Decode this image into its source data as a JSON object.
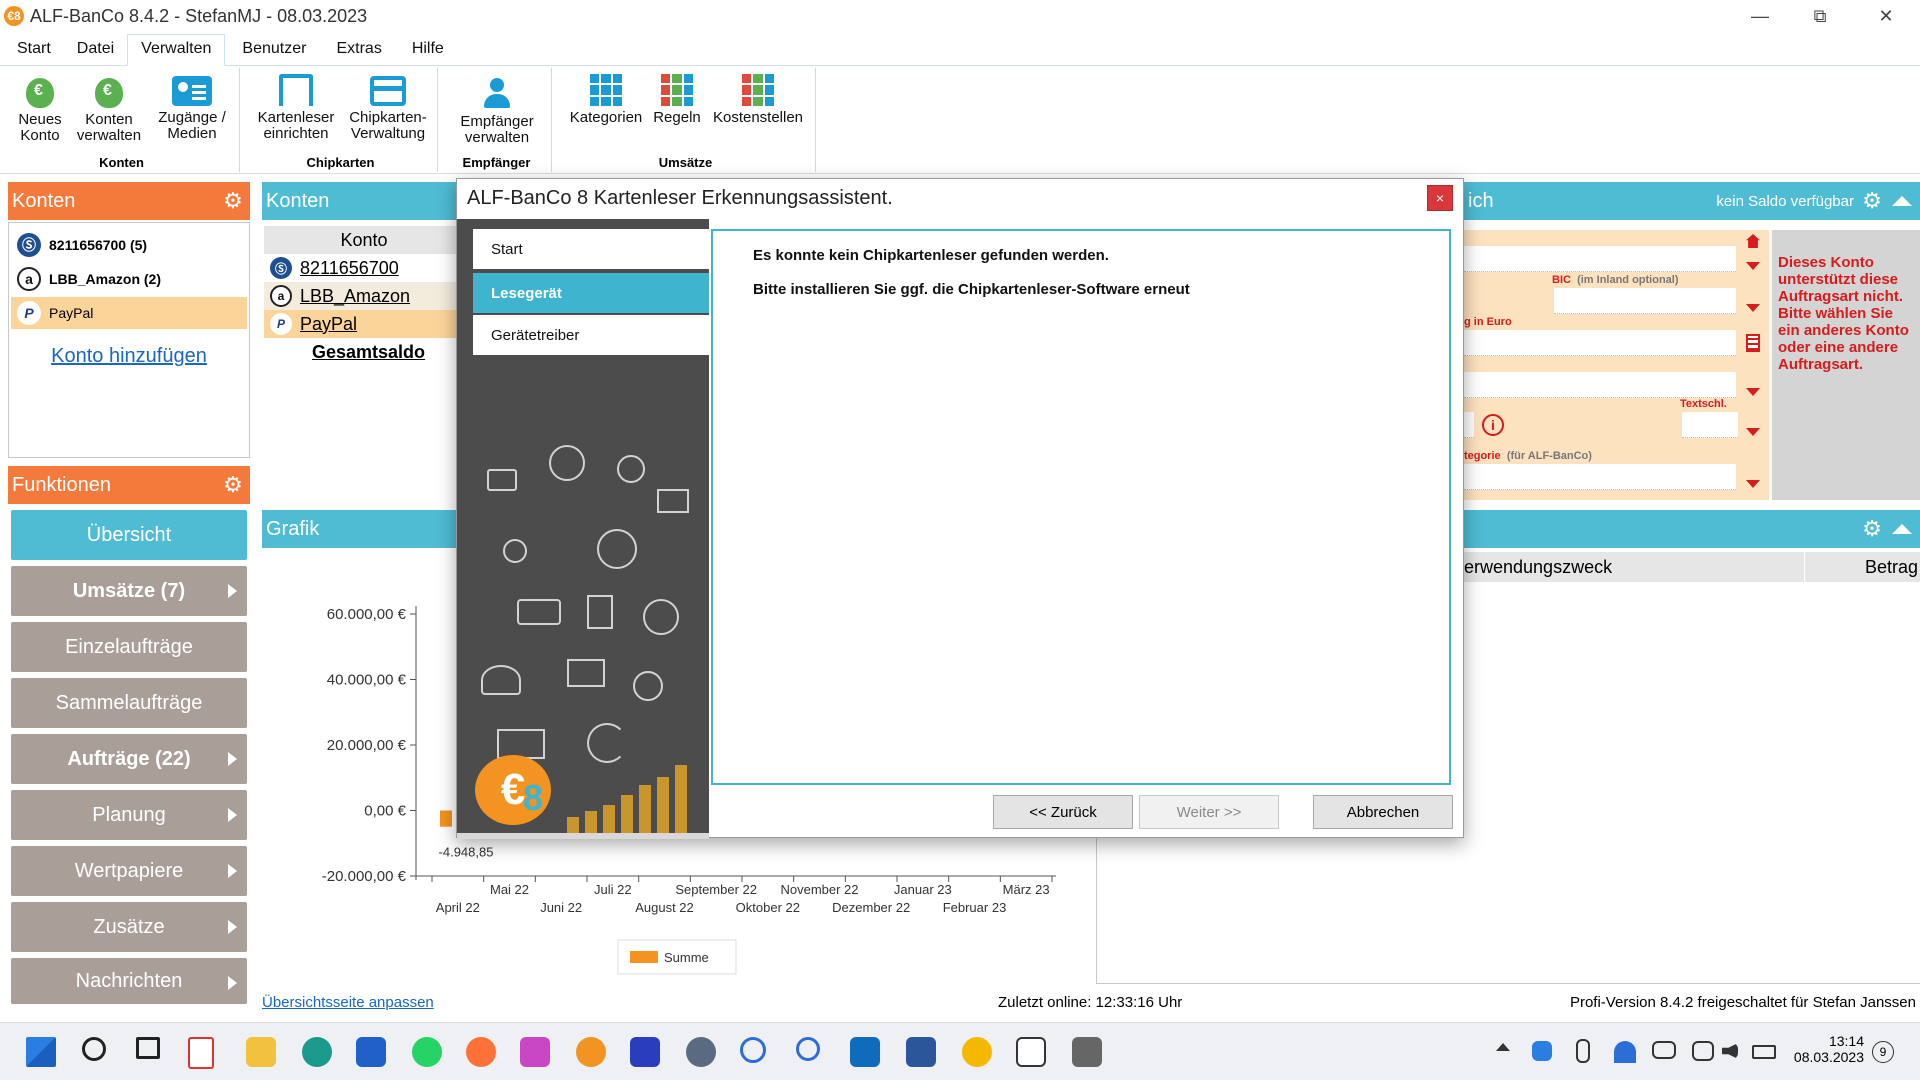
{
  "window": {
    "title": "ALF-BanCo 8.4.2 - StefanMJ   - 08.03.2023",
    "app_icon_glyph": "€8"
  },
  "menu": {
    "tabs": [
      "Start",
      "Datei",
      "Verwalten",
      "Benutzer",
      "Extras",
      "Hilfe"
    ],
    "active_tab": "Verwalten"
  },
  "ribbon": {
    "groups": {
      "konten": "Konten",
      "chipkarten": "Chipkarten",
      "empfaenger": "Empfänger",
      "umsaetze": "Umsätze"
    },
    "buttons": {
      "neues_konto_1": "Neues",
      "neues_konto_2": "Konto",
      "konten_verwalten_1": "Konten",
      "konten_verwalten_2": "verwalten",
      "zugaenge_1": "Zugänge /",
      "zugaenge_2": "Medien",
      "kartenleser_1": "Kartenleser",
      "kartenleser_2": "einrichten",
      "chipkarten_1": "Chipkarten-",
      "chipkarten_2": "Verwaltung",
      "empfaenger_1": "Empfänger",
      "empfaenger_2": "verwalten",
      "kategorien": "Kategorien",
      "regeln": "Regeln",
      "kostenstellen": "Kostenstellen"
    }
  },
  "left": {
    "konten_title": "Konten",
    "accounts": [
      {
        "name": "8211656700 (5)",
        "icon": "sparkasse-icon",
        "glyph": "Ⓢ"
      },
      {
        "name": "LBB_Amazon (2)",
        "icon": "amazon-icon",
        "glyph": "a"
      },
      {
        "name": "PayPal",
        "icon": "paypal-icon",
        "glyph": "P"
      }
    ],
    "add_account": "Konto hinzufügen",
    "funktionen_title": "Funktionen",
    "functions": [
      {
        "label": "Übersicht",
        "arrow": false,
        "bold": false
      },
      {
        "label": "Umsätze (7)",
        "arrow": true,
        "bold": true
      },
      {
        "label": "Einzelaufträge",
        "arrow": false,
        "bold": false
      },
      {
        "label": "Sammelaufträge",
        "arrow": false,
        "bold": false
      },
      {
        "label": "Aufträge (22)",
        "arrow": true,
        "bold": true
      },
      {
        "label": "Planung",
        "arrow": true,
        "bold": false
      },
      {
        "label": "Wertpapiere",
        "arrow": true,
        "bold": false
      },
      {
        "label": "Zusätze",
        "arrow": true,
        "bold": false
      },
      {
        "label": "Nachrichten",
        "arrow": true,
        "bold": false
      }
    ]
  },
  "middle": {
    "konten_title": "Konten",
    "table_header": "Konto",
    "rows": [
      "8211656700",
      "LBB_Amazon",
      "PayPal"
    ],
    "total": "Gesamtsaldo",
    "grafik_title": "Grafik"
  },
  "chart_data": {
    "type": "bar",
    "y_ticks": [
      "60.000,00 €",
      "40.000,00 €",
      "20.000,00 €",
      "0,00 €",
      "-20.000,00 €"
    ],
    "ylim": [
      -20000,
      60000
    ],
    "x_labels_upper": [
      "Mai 22",
      "Juli 22",
      "September 22",
      "November 22",
      "Januar 23",
      "März 23"
    ],
    "x_labels_lower": [
      "April 22",
      "Juni 22",
      "August 22",
      "Oktober 22",
      "Dezember 22",
      "Februar 23"
    ],
    "series": [
      {
        "name": "Summe",
        "values": [
          -4948.85
        ]
      }
    ],
    "data_label": "-4.948,85",
    "color": "#f39321"
  },
  "right": {
    "header_title_fragment": "ich",
    "saldo_text": "kein Saldo verfügbar",
    "labels": {
      "bic": "BIC",
      "bic_hint": "(im Inland optional)",
      "betrag": "g in Euro",
      "textschl": "Textschl.",
      "kategorie": "tegorie",
      "kategorie_hint": "(für ALF-BanCo)"
    },
    "warning": "Dieses Konto unterstützt diese Auftragsart nicht. Bitte wählen Sie ein anderes Konto oder eine andere Auftragsart.",
    "list_headers": [
      "erwendungszweck",
      "Betrag"
    ]
  },
  "status": {
    "customize_link": "Übersichtsseite anpassen",
    "last_online": "Zuletzt online: 12:33:16 Uhr",
    "version": "Profi-Version 8.4.2 freigeschaltet für Stefan Janssen"
  },
  "dialog": {
    "title": "ALF-BanCo 8 Kartenleser Erkennungsassistent.",
    "close_glyph": "×",
    "nav": [
      "Start",
      "Lesegerät",
      "Gerätetreiber"
    ],
    "active_nav": "Lesegerät",
    "message_1": "Es konnte kein Chipkartenleser gefunden werden.",
    "message_2": "Bitte installieren Sie ggf. die Chipkartenleser-Software erneut",
    "buttons": {
      "back": "<< Zurück",
      "next": "Weiter >>",
      "cancel": "Abbrechen"
    }
  },
  "taskbar": {
    "time": "13:14",
    "date": "08.03.2023",
    "notification_count": "9"
  },
  "colors": {
    "orange": "#f47a3c",
    "teal": "#4fbcd3",
    "gray_button": "#a99e98",
    "dialog_accent": "#3fb4cf"
  }
}
